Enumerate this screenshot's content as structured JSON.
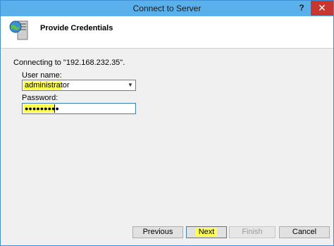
{
  "window": {
    "title": "Connect to Server",
    "help_glyph": "?",
    "close_glyph": "✕"
  },
  "header": {
    "heading": "Provide Credentials",
    "icon": "server-globe-icon"
  },
  "form": {
    "connecting_text": "Connecting to \"192.168.232.35\".",
    "username_label": "User name:",
    "username_value": "administrator",
    "password_label": "Password:",
    "password_value": "●●●●●●●●●"
  },
  "buttons": {
    "previous": "Previous",
    "next": "Next",
    "finish": "Finish",
    "cancel": "Cancel"
  },
  "colors": {
    "titlebar": "#5ab0ea",
    "close": "#c7372f",
    "highlight": "#ffff50"
  }
}
